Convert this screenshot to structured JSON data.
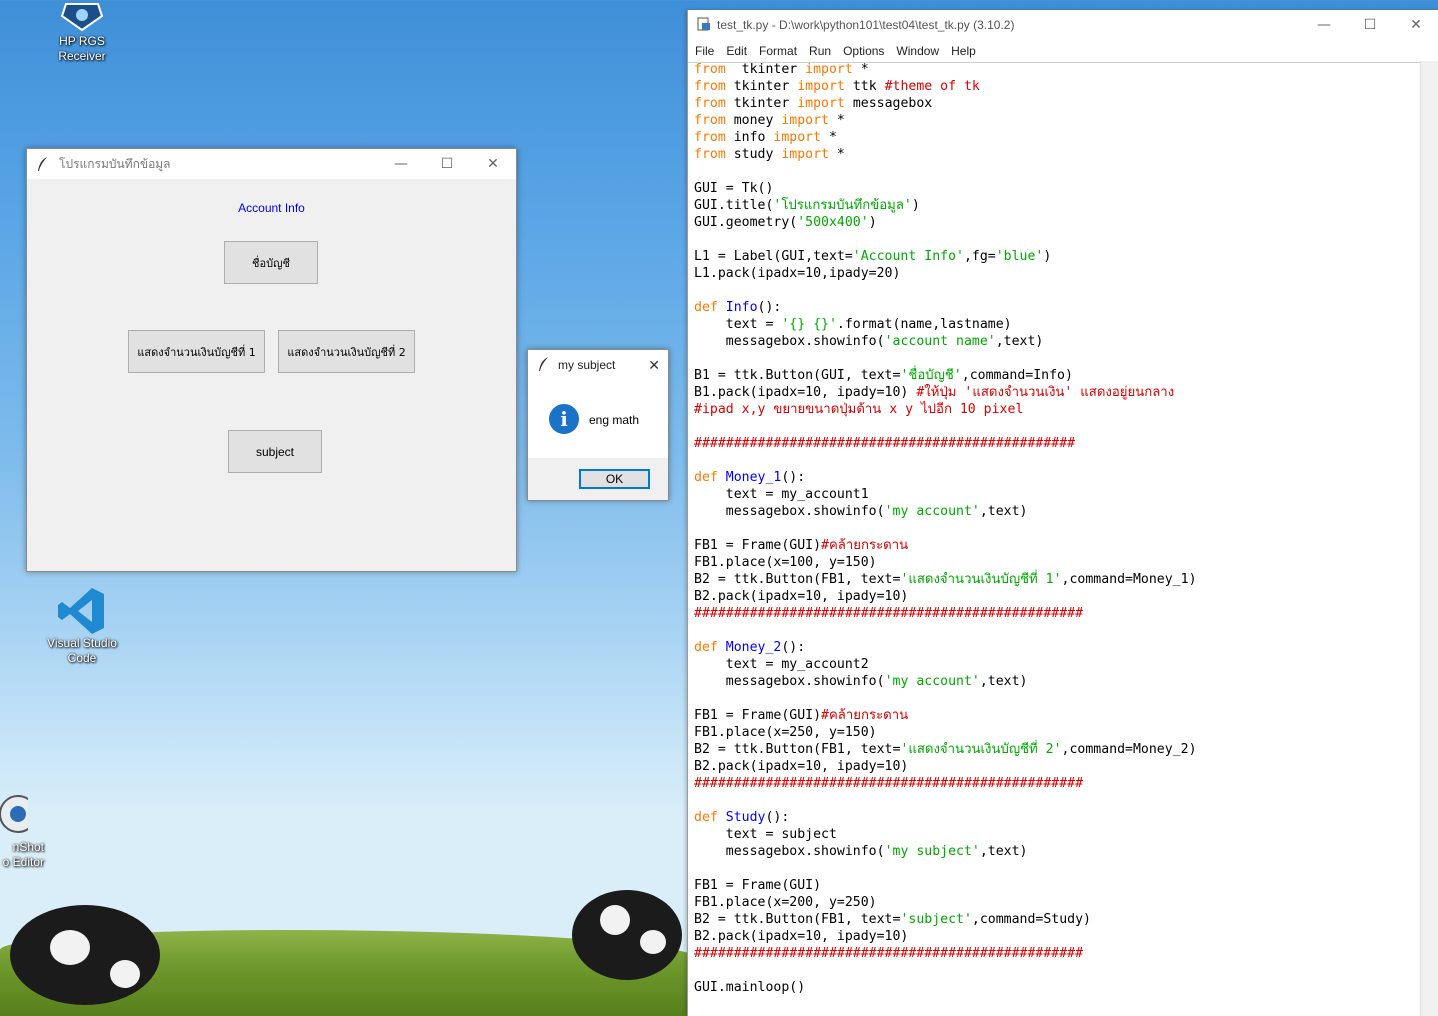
{
  "desktop": {
    "icons": [
      {
        "label": "HP RGS Receiver"
      },
      {
        "label": "Visual Studio Code"
      },
      {
        "label": "nShot\no Editor"
      }
    ]
  },
  "tk_window": {
    "title": "โปรแกรมบันทึกข้อมูล",
    "label": "Account Info",
    "buttons": {
      "account_name": "ชื่อบัญชี",
      "money1": "แสดงจำนวนเงินบัญชีที่ 1",
      "money2": "แสดงจำนวนเงินบัญชีที่ 2",
      "subject": "subject"
    },
    "controls": {
      "minimize": "—",
      "maximize": "☐",
      "close": "✕"
    }
  },
  "dialog": {
    "title": "my subject",
    "message": "eng math",
    "ok": "OK",
    "close": "✕"
  },
  "editor": {
    "title": "test_tk.py - D:\\work\\python101\\test04\\test_tk.py (3.10.2)",
    "menu": [
      "File",
      "Edit",
      "Format",
      "Run",
      "Options",
      "Window",
      "Help"
    ],
    "controls": {
      "minimize": "—",
      "maximize": "☐",
      "close": "✕"
    },
    "code_lines": [
      [
        [
          "kw",
          "from"
        ],
        [
          "",
          "  tkinter "
        ],
        [
          "kw",
          "import"
        ],
        [
          "",
          " *"
        ]
      ],
      [
        [
          "kw",
          "from"
        ],
        [
          "",
          " tkinter "
        ],
        [
          "kw",
          "import"
        ],
        [
          "",
          " ttk "
        ],
        [
          "cm",
          "#theme of tk"
        ]
      ],
      [
        [
          "kw",
          "from"
        ],
        [
          "",
          " tkinter "
        ],
        [
          "kw",
          "import"
        ],
        [
          "",
          " messagebox"
        ]
      ],
      [
        [
          "kw",
          "from"
        ],
        [
          "",
          " money "
        ],
        [
          "kw",
          "import"
        ],
        [
          "",
          " *"
        ]
      ],
      [
        [
          "kw",
          "from"
        ],
        [
          "",
          " info "
        ],
        [
          "kw",
          "import"
        ],
        [
          "",
          " *"
        ]
      ],
      [
        [
          "kw",
          "from"
        ],
        [
          "",
          " study "
        ],
        [
          "kw",
          "import"
        ],
        [
          "",
          " *"
        ]
      ],
      [],
      [
        [
          "",
          "GUI = Tk()"
        ]
      ],
      [
        [
          "",
          "GUI.title("
        ],
        [
          "st",
          "'โปรแกรมบันทึกข้อมูล'"
        ],
        [
          "",
          ")"
        ]
      ],
      [
        [
          "",
          "GUI.geometry("
        ],
        [
          "st",
          "'500x400'"
        ],
        [
          "",
          ")"
        ]
      ],
      [],
      [
        [
          "",
          "L1 = Label(GUI,text="
        ],
        [
          "st",
          "'Account Info'"
        ],
        [
          "",
          ",fg="
        ],
        [
          "st",
          "'blue'"
        ],
        [
          "",
          ")"
        ]
      ],
      [
        [
          "",
          "L1.pack(ipadx=10,ipady=20)"
        ]
      ],
      [],
      [
        [
          "kw",
          "def"
        ],
        [
          "",
          " "
        ],
        [
          "fn",
          "Info"
        ],
        [
          "",
          "():"
        ]
      ],
      [
        [
          "",
          "    text = "
        ],
        [
          "st",
          "'{} {}'"
        ],
        [
          "",
          ".format(name,lastname)"
        ]
      ],
      [
        [
          "",
          "    messagebox.showinfo("
        ],
        [
          "st",
          "'account name'"
        ],
        [
          "",
          ",text)"
        ]
      ],
      [],
      [
        [
          "",
          "B1 = ttk.Button(GUI, text="
        ],
        [
          "st",
          "'ชื่อบัญชี'"
        ],
        [
          "",
          ",command=Info)"
        ]
      ],
      [
        [
          "",
          "B1.pack(ipadx=10, ipady=10) "
        ],
        [
          "cm",
          "#ให้ปุ่ม 'แสดงจำนวนเงิน' แสดงอยู่ยนกลาง"
        ]
      ],
      [
        [
          "cm",
          "#ipad x,y ขยายขนาดปุ่มด้าน x y ไปอีก 10 pixel"
        ]
      ],
      [],
      [
        [
          "cm",
          "################################################"
        ]
      ],
      [],
      [
        [
          "kw",
          "def"
        ],
        [
          "",
          " "
        ],
        [
          "fn",
          "Money_1"
        ],
        [
          "",
          "():"
        ]
      ],
      [
        [
          "",
          "    text = my_account1"
        ]
      ],
      [
        [
          "",
          "    messagebox.showinfo("
        ],
        [
          "st",
          "'my account'"
        ],
        [
          "",
          ",text)"
        ]
      ],
      [],
      [
        [
          "",
          "FB1 = Frame(GUI)"
        ],
        [
          "cm",
          "#คล้ายกระดาน"
        ]
      ],
      [
        [
          "",
          "FB1.place(x=100, y=150)"
        ]
      ],
      [
        [
          "",
          "B2 = ttk.Button(FB1, text="
        ],
        [
          "st",
          "'แสดงจำนวนเงินบัญชีที่ 1'"
        ],
        [
          "",
          ",command=Money_1)"
        ]
      ],
      [
        [
          "",
          "B2.pack(ipadx=10, ipady=10)"
        ]
      ],
      [
        [
          "cm",
          "#################################################"
        ]
      ],
      [],
      [
        [
          "kw",
          "def"
        ],
        [
          "",
          " "
        ],
        [
          "fn",
          "Money_2"
        ],
        [
          "",
          "():"
        ]
      ],
      [
        [
          "",
          "    text = my_account2"
        ]
      ],
      [
        [
          "",
          "    messagebox.showinfo("
        ],
        [
          "st",
          "'my account'"
        ],
        [
          "",
          ",text)"
        ]
      ],
      [],
      [
        [
          "",
          "FB1 = Frame(GUI)"
        ],
        [
          "cm",
          "#คล้ายกระดาน"
        ]
      ],
      [
        [
          "",
          "FB1.place(x=250, y=150)"
        ]
      ],
      [
        [
          "",
          "B2 = ttk.Button(FB1, text="
        ],
        [
          "st",
          "'แสดงจำนวนเงินบัญชีที่ 2'"
        ],
        [
          "",
          ",command=Money_2)"
        ]
      ],
      [
        [
          "",
          "B2.pack(ipadx=10, ipady=10)"
        ]
      ],
      [
        [
          "cm",
          "#################################################"
        ]
      ],
      [],
      [
        [
          "kw",
          "def"
        ],
        [
          "",
          " "
        ],
        [
          "fn",
          "Study"
        ],
        [
          "",
          "():"
        ]
      ],
      [
        [
          "",
          "    text = subject"
        ]
      ],
      [
        [
          "",
          "    messagebox.showinfo("
        ],
        [
          "st",
          "'my subject'"
        ],
        [
          "",
          ",text)"
        ]
      ],
      [],
      [
        [
          "",
          "FB1 = Frame(GUI)"
        ]
      ],
      [
        [
          "",
          "FB1.place(x=200, y=250)"
        ]
      ],
      [
        [
          "",
          "B2 = ttk.Button(FB1, text="
        ],
        [
          "st",
          "'subject'"
        ],
        [
          "",
          ",command=Study)"
        ]
      ],
      [
        [
          "",
          "B2.pack(ipadx=10, ipady=10)"
        ]
      ],
      [
        [
          "cm",
          "#################################################"
        ]
      ],
      [],
      [
        [
          "",
          "GUI.mainloop()"
        ]
      ]
    ]
  }
}
